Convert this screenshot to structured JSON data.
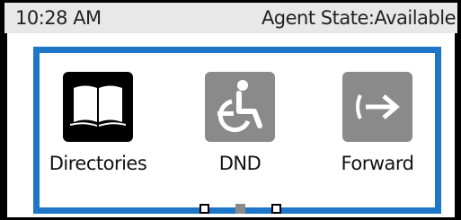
{
  "status_bar": {
    "time": "10:28 AM",
    "agent_state": "Agent State:Available"
  },
  "features": [
    {
      "label": "Directories",
      "icon": "book-icon",
      "active": true
    },
    {
      "label": "DND",
      "icon": "do-not-disturb-icon",
      "active": false
    },
    {
      "label": "Forward",
      "icon": "forward-arrow-icon",
      "active": false
    }
  ],
  "pagination": {
    "page_count": 3,
    "current_page": 2
  },
  "colors": {
    "selection_frame": "#1e76c9",
    "active_tile": "#000000",
    "inactive_tile": "#8a8a8a",
    "status_bar_background": "#e8e8e8"
  }
}
